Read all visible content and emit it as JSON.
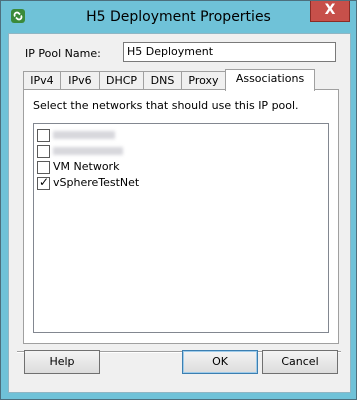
{
  "window": {
    "title": "H5 Deployment Properties",
    "close_label": "X"
  },
  "pool": {
    "label": "IP Pool Name:",
    "value": "H5 Deployment"
  },
  "tabs": [
    {
      "label": "IPv4"
    },
    {
      "label": "IPv6"
    },
    {
      "label": "DHCP"
    },
    {
      "label": "DNS"
    },
    {
      "label": "Proxy"
    },
    {
      "label": "Associations"
    }
  ],
  "panel": {
    "instructions": "Select the networks that should use this IP pool.",
    "networks": [
      {
        "label": "",
        "checked": false,
        "redacted": true
      },
      {
        "label": "",
        "checked": false,
        "redacted": true
      },
      {
        "label": "VM Network",
        "checked": false
      },
      {
        "label": "vSphereTestNet",
        "checked": true
      }
    ]
  },
  "buttons": {
    "help": "Help",
    "ok": "OK",
    "cancel": "Cancel"
  },
  "colors": {
    "titlebar": "#6fc2d8",
    "close": "#c7504a"
  },
  "icons": {
    "app": "vsphere-link-icon",
    "check": "✓"
  }
}
